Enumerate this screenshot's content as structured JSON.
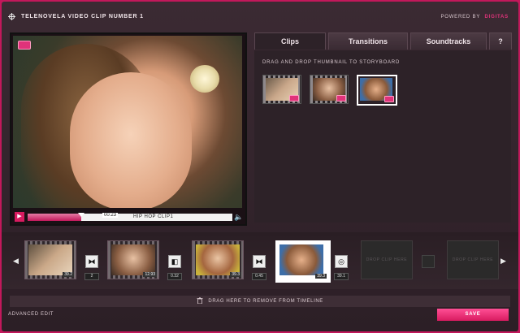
{
  "window": {
    "title": "TELENOVELA VIDEO CLIP NUMBER 1",
    "powered_by_label": "POWERED BY",
    "powered_by_brand": "DIGITAS"
  },
  "player": {
    "timecode": "00:23",
    "clip_name": "HIP HOP CLIP1",
    "progress_fraction": 0.26
  },
  "library": {
    "tabs": [
      {
        "label": "Clips"
      },
      {
        "label": "Transitions"
      },
      {
        "label": "Soundtracks"
      },
      {
        "label": "?"
      }
    ],
    "active_tab": "Clips",
    "hint": "DRAG AND DROP THUMBNAIL TO STORYBOARD"
  },
  "timeline": {
    "clips": [
      {
        "duration": "39.2"
      },
      {
        "duration": "12.93"
      },
      {
        "duration": "39.3"
      },
      {
        "duration": "39.3"
      }
    ],
    "transitions": [
      {
        "duration": "2"
      },
      {
        "duration": "0.32"
      },
      {
        "duration": "0.45"
      },
      {
        "duration": "39.1"
      }
    ],
    "empty_slot_label": "DROP CLIP HERE"
  },
  "footer": {
    "drop_hint": "DRAG HERE TO REMOVE FROM TIMELINE",
    "advanced_label": "ADVANCED EDIT",
    "save_label": "SAVE"
  },
  "colors": {
    "accent": "#d81b60",
    "frame": "#c2185b"
  }
}
